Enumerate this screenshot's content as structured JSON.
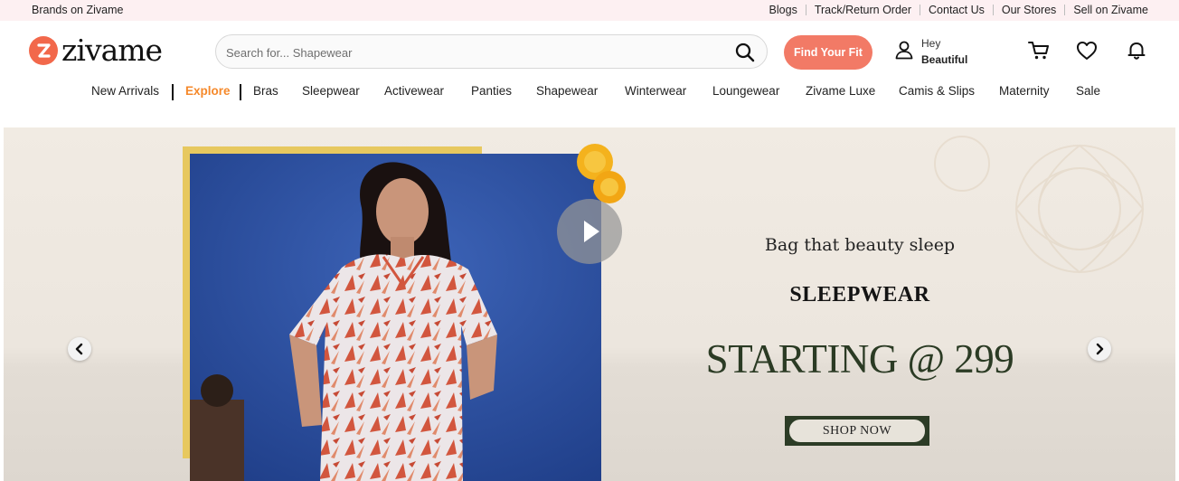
{
  "topbar": {
    "brands_label": "Brands on Zivame",
    "links": [
      "Blogs",
      "Track/Return Order",
      "Contact Us",
      "Our Stores",
      "Sell on Zivame"
    ]
  },
  "header": {
    "logo_text": "zivame",
    "search": {
      "placeholder": "Search for... Shapewear"
    },
    "fit_button": "Find Your Fit",
    "account": {
      "greeting": "Hey",
      "name": "Beautiful"
    }
  },
  "nav": {
    "items": [
      "New Arrivals",
      "Explore",
      "Bras",
      "Sleepwear",
      "Activewear",
      "Panties",
      "Shapewear",
      "Winterwear",
      "Loungewear",
      "Zivame Luxe",
      "Camis & Slips",
      "Maternity",
      "Sale"
    ]
  },
  "hero": {
    "subtitle": "Bag that beauty sleep",
    "title": "SLEEPWEAR",
    "price": "STARTING @ 299",
    "cta": "SHOP NOW"
  },
  "colors": {
    "brand": "#f2684b",
    "fit_button": "#f27a66",
    "explore": "#f5892b",
    "topbar_bg": "#fdf0f2",
    "cta_bg": "#2c3c26"
  },
  "icons": [
    "search-icon",
    "user-icon",
    "cart-icon",
    "heart-icon",
    "bell-icon",
    "play-icon",
    "chevron-left-icon",
    "chevron-right-icon"
  ]
}
